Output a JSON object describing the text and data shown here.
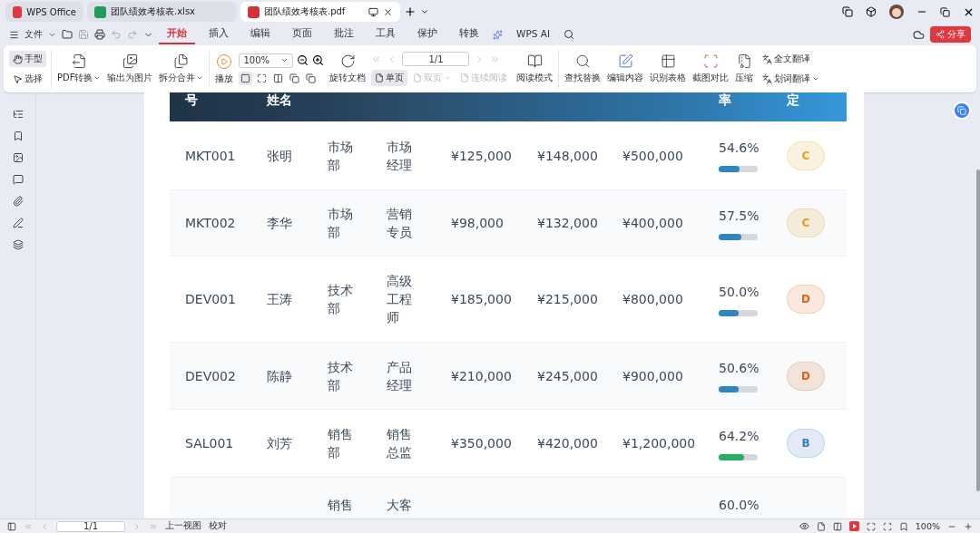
{
  "tabs": [
    {
      "label": "WPS Office",
      "kind": "home",
      "selected": false
    },
    {
      "label": "团队绩效考核表.xlsx",
      "kind": "sheet",
      "selected": false
    },
    {
      "label": "团队绩效考核表.pdf",
      "kind": "pdf",
      "selected": true
    }
  ],
  "menu": {
    "file": "文件",
    "ribbon_tabs": [
      {
        "label": "开始",
        "selected": true
      },
      {
        "label": "插入",
        "selected": false
      },
      {
        "label": "编辑",
        "selected": false
      },
      {
        "label": "页面",
        "selected": false
      },
      {
        "label": "批注",
        "selected": false
      },
      {
        "label": "工具",
        "selected": false
      },
      {
        "label": "保护",
        "selected": false
      },
      {
        "label": "转换",
        "selected": false
      },
      {
        "label": "WPS AI",
        "selected": false
      }
    ],
    "share": "分享"
  },
  "toolbar": {
    "pointer_modes": [
      {
        "label": "手型",
        "selected": true
      },
      {
        "label": "选择",
        "selected": false
      }
    ],
    "file_tools": [
      {
        "label": "PDF转换",
        "dropdown": true
      },
      {
        "label": "输出为图片",
        "dropdown": false
      },
      {
        "label": "拆分合并",
        "dropdown": true
      }
    ],
    "play": "播放",
    "zoom": "100%",
    "fit_modes": [
      {
        "selected": true
      },
      {
        "selected": false
      },
      {
        "selected": false
      },
      {
        "selected": false
      },
      {
        "selected": false
      }
    ],
    "rotate": "旋转文档",
    "page_modes": [
      {
        "label": "单页",
        "selected": true,
        "disabled": false,
        "dropdown": false
      },
      {
        "label": "双页",
        "selected": false,
        "disabled": true,
        "dropdown": true
      },
      {
        "label": "连续阅读",
        "selected": false,
        "disabled": true,
        "dropdown": false
      }
    ],
    "page_field": "1/1",
    "read_mode": "阅读模式",
    "tools": [
      "查找替换",
      "编辑内容",
      "识别表格",
      "截图对比",
      "压缩"
    ],
    "translate": [
      {
        "label": "全文翻译",
        "dropdown": false
      },
      {
        "label": "划词翻译",
        "dropdown": true
      }
    ]
  },
  "table": {
    "columns": [
      "号",
      "姓名",
      "",
      "",
      "",
      "",
      "",
      "率",
      "定"
    ],
    "rows": [
      {
        "cells": [
          "MKT001",
          "张明",
          "市场部",
          "市场经理",
          "¥125,000",
          "¥148,000",
          "¥500,000"
        ],
        "rate": "54.6%",
        "progress": {
          "level": 0.546,
          "color": "#2e86c1"
        },
        "grade": {
          "letter": "C",
          "color": "#e0a020"
        }
      },
      {
        "cells": [
          "MKT002",
          "李华",
          "市场部",
          "营销专员",
          "¥98,000",
          "¥132,000",
          "¥400,000"
        ],
        "rate": "57.5%",
        "progress": {
          "level": 0.575,
          "color": "#2e86c1"
        },
        "grade": {
          "letter": "C",
          "color": "#e0a020"
        }
      },
      {
        "cells": [
          "DEV001",
          "王涛",
          "技术部",
          "高级工程师",
          "¥185,000",
          "¥215,000",
          "¥800,000"
        ],
        "rate": "50.0%",
        "progress": {
          "level": 0.5,
          "color": "#2e86c1"
        },
        "grade": {
          "letter": "D",
          "color": "#d9631a"
        }
      },
      {
        "cells": [
          "DEV002",
          "陈静",
          "技术部",
          "产品经理",
          "¥210,000",
          "¥245,000",
          "¥900,000"
        ],
        "rate": "50.6%",
        "progress": {
          "level": 0.506,
          "color": "#2e86c1"
        },
        "grade": {
          "letter": "D",
          "color": "#d9631a"
        }
      },
      {
        "cells": [
          "SAL001",
          "刘芳",
          "销售部",
          "销售总监",
          "¥350,000",
          "¥420,000",
          "¥1,200,000"
        ],
        "rate": "64.2%",
        "progress": {
          "level": 0.642,
          "color": "#27ae60"
        },
        "grade": {
          "letter": "B",
          "color": "#3a7bbf"
        }
      },
      {
        "cells": [
          "",
          "",
          "销售",
          "大客",
          "",
          "",
          ""
        ],
        "rate": "60.0%"
      }
    ]
  },
  "status_bar": {
    "page_field": "1/1",
    "prev_view": "上一视图",
    "proofread": "校对",
    "zoom": "100%"
  }
}
